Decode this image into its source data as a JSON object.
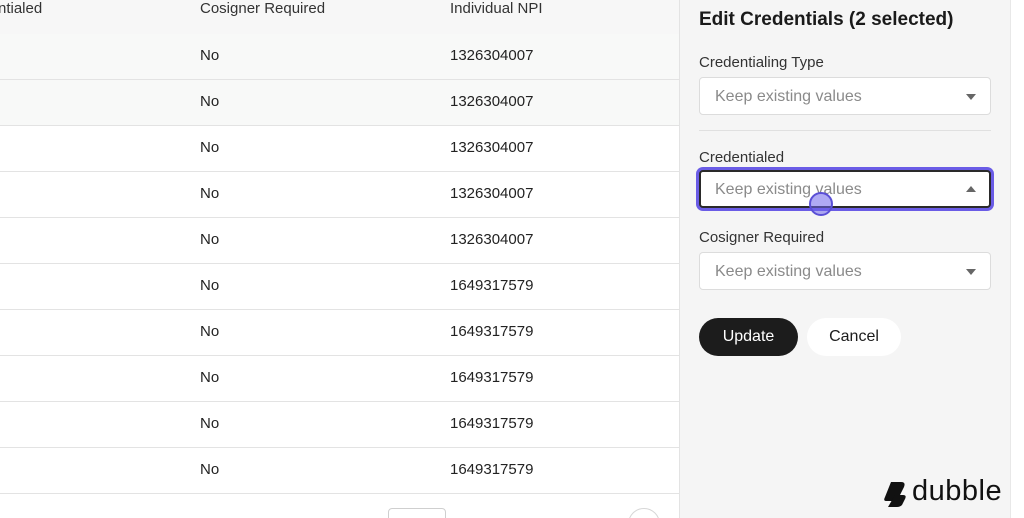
{
  "table": {
    "headers": {
      "credentialed": "ntialed",
      "cosigner_required": "Cosigner Required",
      "individual_npi": "Individual NPI"
    },
    "rows": [
      {
        "cosigner": "No",
        "npi": "1326304007"
      },
      {
        "cosigner": "No",
        "npi": "1326304007"
      },
      {
        "cosigner": "No",
        "npi": "1326304007"
      },
      {
        "cosigner": "No",
        "npi": "1326304007"
      },
      {
        "cosigner": "No",
        "npi": "1326304007"
      },
      {
        "cosigner": "No",
        "npi": "1649317579"
      },
      {
        "cosigner": "No",
        "npi": "1649317579"
      },
      {
        "cosigner": "No",
        "npi": "1649317579"
      },
      {
        "cosigner": "No",
        "npi": "1649317579"
      },
      {
        "cosigner": "No",
        "npi": "1649317579"
      }
    ]
  },
  "panel": {
    "title": "Edit Credentials (2 selected)",
    "fields": [
      {
        "label": "Credentialing Type",
        "value": "Keep existing values"
      },
      {
        "label": "Credentialed",
        "value": "Keep existing values"
      },
      {
        "label": "Cosigner Required",
        "value": "Keep existing values"
      }
    ],
    "update_label": "Update",
    "cancel_label": "Cancel"
  },
  "brand": {
    "name": "dubble"
  },
  "colors": {
    "focus_ring": "#6a5ce6",
    "primary_button": "#1c1c1c"
  }
}
